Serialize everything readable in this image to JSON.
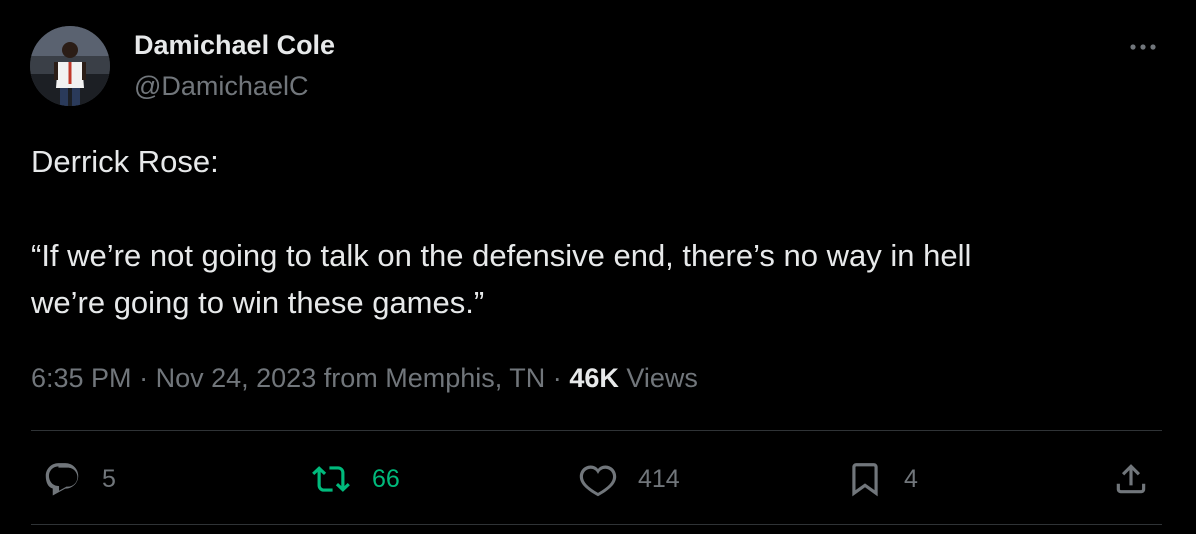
{
  "author": {
    "name": "Damichael Cole",
    "handle": "@DamichaelC"
  },
  "tweet": {
    "line1": "Derrick Rose:",
    "quote_line1": "“If we’re not going to talk on the defensive end, there’s no way in hell",
    "quote_line2": "we’re going to win these games.”"
  },
  "meta": {
    "time": "6:35 PM",
    "separator": "·",
    "date": "Nov 24, 2023",
    "location": "from Memphis, TN",
    "views_count": "46K",
    "views_label": "Views"
  },
  "actions": {
    "replies": "5",
    "retweets": "66",
    "likes": "414",
    "bookmarks": "4"
  },
  "icons": {
    "more": "more-horizontal-icon",
    "reply": "reply-icon",
    "retweet": "retweet-icon",
    "like": "heart-icon",
    "bookmark": "bookmark-icon",
    "share": "share-icon"
  },
  "colors": {
    "background": "#000000",
    "text_primary": "#e7e9ea",
    "text_secondary": "#71767b",
    "retweet_active": "#00ba7c",
    "divider": "#2f3336"
  }
}
